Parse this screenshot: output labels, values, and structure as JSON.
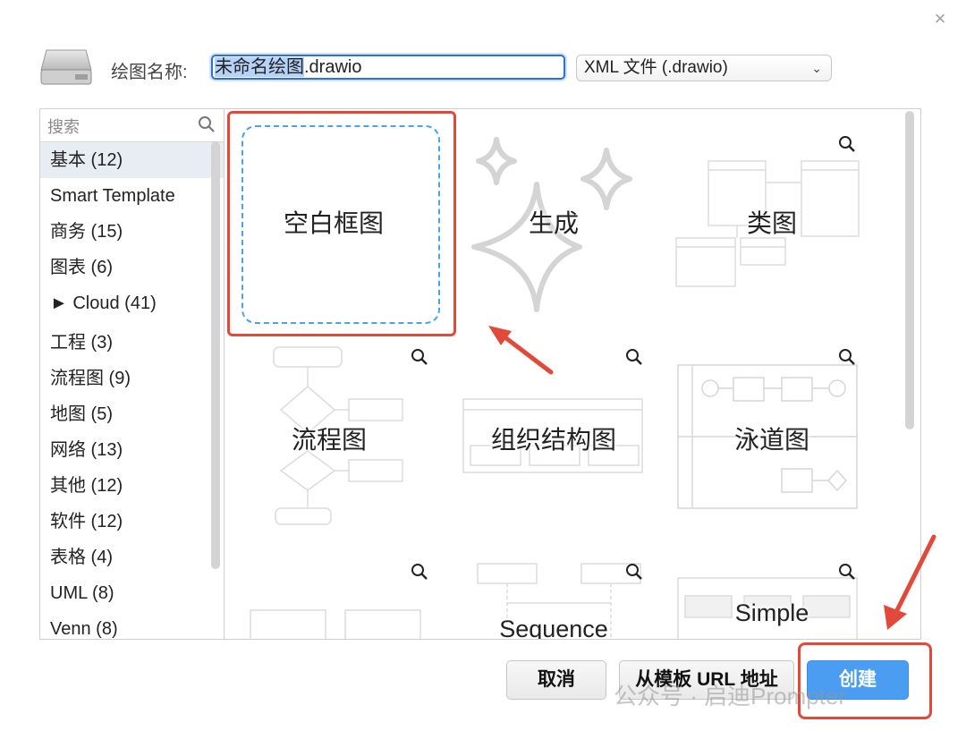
{
  "window": {
    "close_symbol": "×"
  },
  "header": {
    "name_label": "绘图名称:",
    "filename_selected": "未命名绘图",
    "filename_rest": ".drawio",
    "format_value": "XML 文件 (.drawio)"
  },
  "sidebar": {
    "search_placeholder": "搜索",
    "items": [
      {
        "label": "基本 (12)"
      },
      {
        "label": "Smart Template"
      },
      {
        "label": "商务 (15)"
      },
      {
        "label": "图表 (6)"
      },
      {
        "label": "► Cloud (41)"
      },
      {
        "label": "工程 (3)"
      },
      {
        "label": "流程图 (9)"
      },
      {
        "label": "地图 (5)"
      },
      {
        "label": "网络 (13)"
      },
      {
        "label": "其他 (12)"
      },
      {
        "label": "软件 (12)"
      },
      {
        "label": "表格 (4)"
      },
      {
        "label": "UML (8)"
      },
      {
        "label": "Venn (8)"
      }
    ]
  },
  "templates": {
    "blank": "空白框图",
    "generate": "生成",
    "class": "类图",
    "flowchart": "流程图",
    "orgchart": "组织结构图",
    "swimlane": "泳道图",
    "sequence": "Sequence",
    "simple": "Simple"
  },
  "buttons": {
    "cancel": "取消",
    "from_url": "从模板 URL 地址",
    "create": "创建"
  },
  "watermark": "公众号 · 启迪Prompter",
  "colors": {
    "accent_blue": "#4a9df0",
    "highlight_red": "#e2493a",
    "dashed_blue": "#4aa3e8"
  }
}
